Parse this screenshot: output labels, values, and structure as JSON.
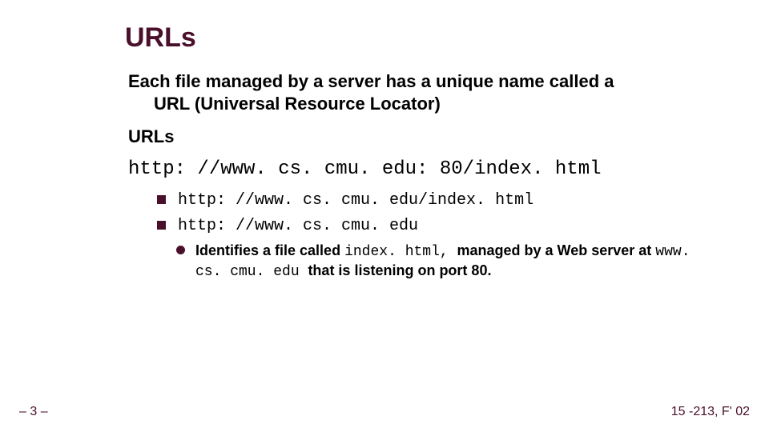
{
  "title": "URLs",
  "intro_line1": "Each file managed by a server has a unique name called a",
  "intro_line2": "URL (Universal Resource Locator)",
  "subheading": "URLs",
  "main_url": "http: //www. cs. cmu. edu: 80/index. html",
  "bullets": [
    "http: //www. cs. cmu. edu/index. html",
    "http: //www. cs. cmu. edu"
  ],
  "sub_bullet": {
    "pre": "Identifies a file called ",
    "code1": "index. html, ",
    "mid": "managed by a Web server at ",
    "code2": "www. cs. cmu. edu ",
    "post": "that is listening on port 80."
  },
  "footer_left": "– 3 –",
  "footer_right": "15 -213, F' 02"
}
